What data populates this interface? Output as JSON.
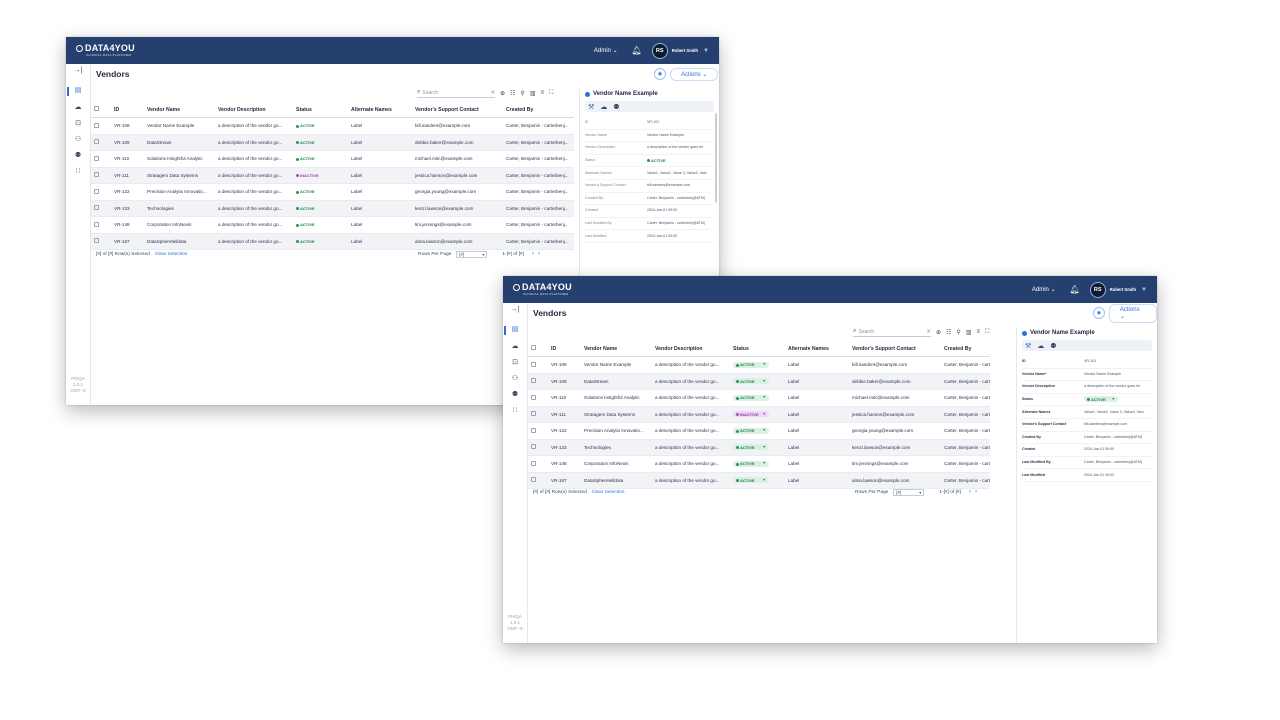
{
  "app": {
    "logo_main": "DATA4YOU",
    "logo_sub": "CLINICAL DATA PLATFORM",
    "admin_label": "Admin ⌄",
    "user_initials": "RS",
    "user_name": "Robert Smith"
  },
  "page": {
    "title": "Vendors",
    "actions_label": "Actions ⌄",
    "search_placeholder": "Search"
  },
  "rail": {
    "footer_back": [
      "PHiQA",
      "1.0.1",
      "GMT -5"
    ],
    "footer_front": [
      "PHiQA",
      "1.0.1",
      "GMT -5"
    ]
  },
  "columns": [
    "ID",
    "Vendor Name",
    "Vendor Description",
    "Status",
    "Alternate Names",
    "Vendor's Support Contact",
    "Created By"
  ],
  "rows": [
    {
      "id": "VR-108",
      "name": "Vendor Name Example",
      "desc": "a description of the vendor go...",
      "status": "ACTIVE",
      "alt": "Label",
      "contact": "bill.sanders@example.com",
      "created": "Carter, Benjamin - carterbenj..."
    },
    {
      "id": "VR-109",
      "name": "DataStream",
      "desc": "a description of the vendor go...",
      "status": "ACTIVE",
      "alt": "Label",
      "contact": "debbie.baker@example.com",
      "created": "Carter, Benjamin - carterbenj..."
    },
    {
      "id": "VR-110",
      "name": "Solutions Insightful Analytic",
      "desc": "a description of the vendor go...",
      "status": "ACTIVE",
      "alt": "Label",
      "contact": "michael.mitc@example.com",
      "created": "Carter, Benjamin - carterbenj..."
    },
    {
      "id": "VR-111",
      "name": "Stratagem Data Systems",
      "desc": "a description of the vendor go...",
      "status": "INACTIVE",
      "alt": "Label",
      "contact": "jessica.hanson@example.com",
      "created": "Carter, Benjamin - carterbenj..."
    },
    {
      "id": "VR-122",
      "name": "Precision Analytix Innovatio...",
      "desc": "a description of the vendor go...",
      "status": "ACTIVE",
      "alt": "Label",
      "contact": "georgia.young@example.com",
      "created": "Carter, Benjamin - carterbenj..."
    },
    {
      "id": "VR-133",
      "name": "Technologies",
      "desc": "a description of the vendor go...",
      "status": "ACTIVE",
      "alt": "Label",
      "contact": "kenzi.lawson@example.com",
      "created": "Carter, Benjamin - carterbenj..."
    },
    {
      "id": "VR-148",
      "name": "Corporation InfoNexis",
      "desc": "a description of the vendor go...",
      "status": "ACTIVE",
      "alt": "Label",
      "contact": "tim.jennings@example.com",
      "created": "Carter, Benjamin - carterbenj..."
    },
    {
      "id": "VR-167",
      "name": "DataSpheretelldata",
      "desc": "a description of the vendor go...",
      "status": "ACTIVE",
      "alt": "Label",
      "contact": "alma.lawson@example.com",
      "created": "Carter, Benjamin - carterbenj..."
    }
  ],
  "footer": {
    "selected": "[#] of [#] Row(s) Selected",
    "clear": "Clear Selection",
    "rows_per_page": "Rows Per Page",
    "rpp_value": "[#]",
    "range": "1-[#] of [#]"
  },
  "panel": {
    "title": "Vendor Name Example",
    "fields_back": [
      {
        "k": "ID",
        "v": "VR-101"
      },
      {
        "k": "Vendor Name",
        "v": "Vendor Name Example"
      },
      {
        "k": "Vendor Description",
        "v": "a description of the vendor goes he"
      },
      {
        "k": "Status",
        "v": "ACTIVE"
      },
      {
        "k": "Alternate Names",
        "v": "Value1, Value2, Value 3, Value4, Valu"
      },
      {
        "k": "Vendor's Support Contact",
        "v": "bill.sanders@example.com"
      },
      {
        "k": "Created By",
        "v": "Carter, Benjamin - carterbenj@ATM)"
      },
      {
        "k": "Created",
        "v": "2024-Jan-01 09:00"
      },
      {
        "k": "Last Modified By",
        "v": "Carter, Benjamin - carterbenj@ATM)"
      },
      {
        "k": "Last Modified",
        "v": "2024-Jan-01 09:00"
      }
    ],
    "fields_front": [
      {
        "k": "ID",
        "v": "VR-101"
      },
      {
        "k": "Vendor Name*",
        "v": "Vendor Name Example"
      },
      {
        "k": "Vendor Description",
        "v": "a description of the vendor goes he"
      },
      {
        "k": "Status",
        "v": "ACTIVE"
      },
      {
        "k": "Alternate Names",
        "v": "Value1, Value2, Value 3, Value4, Valu"
      },
      {
        "k": "Vendor's Support Contact",
        "v": "bill.sanders@example.com"
      },
      {
        "k": "Created By",
        "v": "Carter, Benjamin - carterbenj@ATM)"
      },
      {
        "k": "Created",
        "v": "2024-Jan-01 09:00"
      },
      {
        "k": "Last Modified By",
        "v": "Carter, Benjamin - carterbenj@ATM)"
      },
      {
        "k": "Last Modified",
        "v": "2024-Jan-01 09:00"
      }
    ]
  },
  "colors": {
    "header": "#25406e",
    "accent": "#2d6fd8",
    "active": "#1e7e4a",
    "inactive": "#9b3fb5"
  }
}
